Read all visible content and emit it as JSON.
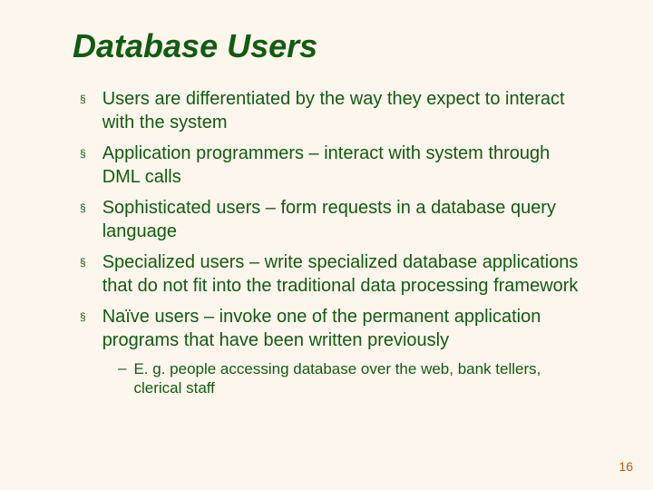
{
  "title": "Database Users",
  "bullets": [
    "Users are differentiated by the way they expect to interact with the system",
    "Application programmers – interact with system through DML calls",
    "Sophisticated users – form requests in a database query language",
    "Specialized users – write specialized database applications that do not fit into the traditional data processing framework",
    "Naïve users – invoke one of the permanent application programs that have been written previously"
  ],
  "sub_bullets": [
    "E. g. people accessing database over the web, bank tellers, clerical staff"
  ],
  "page_number": "16"
}
